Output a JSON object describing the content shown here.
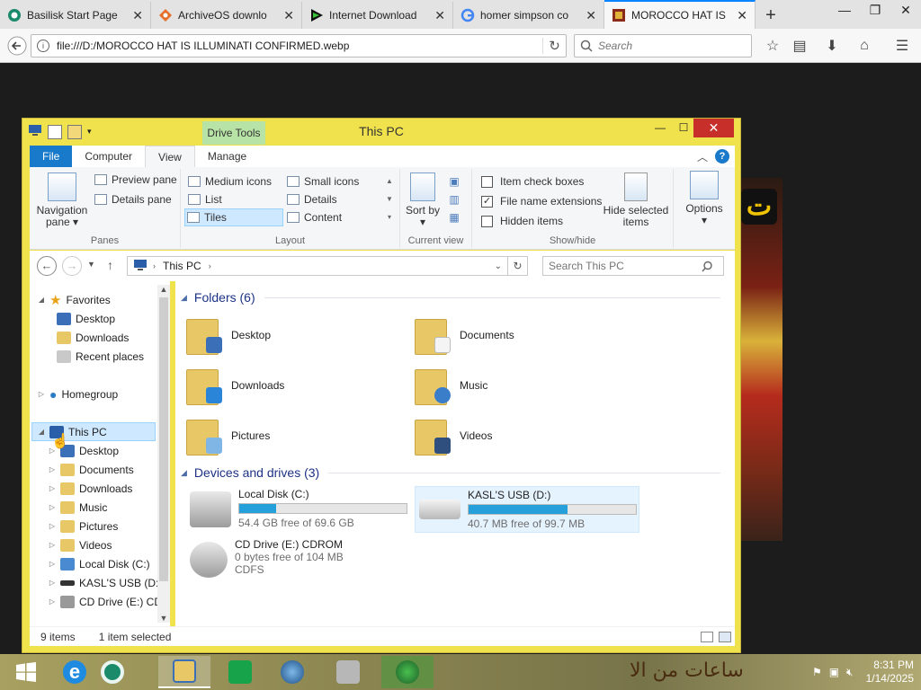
{
  "browser": {
    "tabs": [
      {
        "title": "Basilisk Start Page",
        "icon": "basilisk-icon",
        "active": false
      },
      {
        "title": "ArchiveOS downlo",
        "icon": "archiveos-icon",
        "active": false
      },
      {
        "title": "Internet Download",
        "icon": "play-icon",
        "active": false
      },
      {
        "title": "homer simpson co",
        "icon": "google-icon",
        "active": false
      },
      {
        "title": "MOROCCO HAT IS",
        "icon": "image-icon",
        "active": true
      }
    ],
    "url": "file:///D:/MOROCCO HAT IS ILLUMINATI CONFIRMED.webp",
    "search_placeholder": "Search",
    "page_image_text": "ت"
  },
  "explorer": {
    "title": "This PC",
    "contextual_tab": "Drive Tools",
    "ribbon_tabs": [
      "File",
      "Computer",
      "View",
      "Manage"
    ],
    "active_tab": "View",
    "groups": {
      "panes": {
        "label": "Panes",
        "navigation_pane": "Navigation pane",
        "preview_pane": "Preview pane",
        "details_pane": "Details pane"
      },
      "layout": {
        "label": "Layout",
        "items": [
          "Medium icons",
          "Small icons",
          "List",
          "Details",
          "Tiles",
          "Content"
        ],
        "selected": "Tiles"
      },
      "current_view": {
        "label": "Current view",
        "sort_by": "Sort by"
      },
      "show_hide": {
        "label": "Show/hide",
        "item_check_boxes": "Item check boxes",
        "file_name_extensions": "File name extensions",
        "hidden_items": "Hidden items",
        "item_check_boxes_checked": false,
        "file_name_extensions_checked": true,
        "hidden_items_checked": false,
        "hide_selected_items": "Hide selected items"
      },
      "options": "Options"
    },
    "address": "This PC",
    "search_placeholder": "Search This PC",
    "nav": {
      "favorites": "Favorites",
      "favorites_items": [
        "Desktop",
        "Downloads",
        "Recent places"
      ],
      "homegroup": "Homegroup",
      "this_pc": "This PC",
      "this_pc_items": [
        "Desktop",
        "Documents",
        "Downloads",
        "Music",
        "Pictures",
        "Videos",
        "Local Disk (C:)",
        "KASL'S USB (D:)",
        "CD Drive (E:) CDF"
      ]
    },
    "folders_header": "Folders (6)",
    "folders": [
      "Desktop",
      "Documents",
      "Downloads",
      "Music",
      "Pictures",
      "Videos"
    ],
    "drives_header": "Devices and drives (3)",
    "drives": [
      {
        "name": "Local Disk (C:)",
        "free": "54.4 GB free of 69.6 GB",
        "used_fraction": 0.22
      },
      {
        "name": "KASL'S USB (D:)",
        "free": "40.7 MB free of 99.7 MB",
        "used_fraction": 0.59
      },
      {
        "name": "CD Drive (E:) CDROM",
        "free": "0 bytes free of 104 MB",
        "fs": "CDFS"
      }
    ],
    "status": {
      "items": "9 items",
      "selected": "1 item selected"
    }
  },
  "taskbar": {
    "items": [
      "start-icon",
      "internet-explorer-icon",
      "basilisk-icon",
      "file-explorer-icon",
      "store-icon",
      "browser-globe-icon",
      "printer-tool-icon",
      "idm-icon"
    ],
    "active": "file-explorer-icon",
    "wallpaper_text": "ساعات من الا",
    "time": "8:31 PM",
    "date": "1/14/2025"
  },
  "colors": {
    "accent": "#1979ca",
    "window_frame": "#f0e24c",
    "close": "#c7302a",
    "selection": "#cde8ff",
    "drive_bar": "#26a0da"
  }
}
